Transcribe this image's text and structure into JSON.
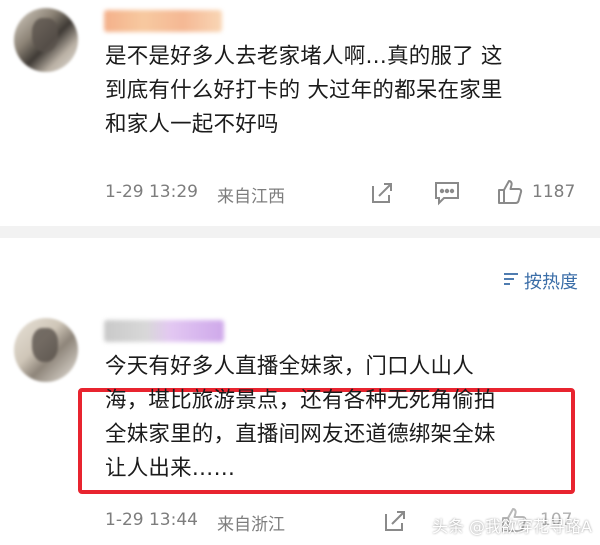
{
  "comments": [
    {
      "text_lines": [
        "是不是好多人去老家堵人啊…真的服了 这",
        "到底有什么好打卡的 大过年的都呆在家里",
        "和家人一起不好吗"
      ],
      "time": "1-29 13:29",
      "location": "来自江西",
      "likes": "1187"
    },
    {
      "text_lines": [
        "今天有好多人直播全妹家，门口人山人",
        "海，堪比旅游景点，还有各种无死角偷拍",
        "全妹家里的，直播间网友还道德绑架全妹",
        "让人出来……"
      ],
      "time": "1-29 13:44",
      "location": "来自浙江",
      "likes": "107"
    }
  ],
  "sort": {
    "label": "按热度"
  },
  "watermark": "头条 @我欲穿花寻路A",
  "colors": {
    "highlight": "#e8242f",
    "link": "#3b6ea8",
    "meta": "#7d7d7d"
  }
}
